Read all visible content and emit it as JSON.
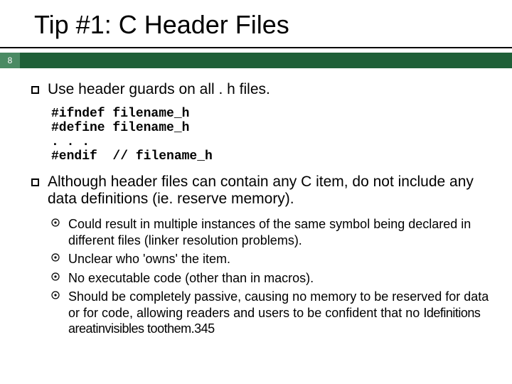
{
  "title": "Tip #1: C Header Files",
  "page_number": "8",
  "bullets": {
    "b1": "Use header guards on all . h files.",
    "code": "#ifndef filename_h\n#define filename_h\n. . .\n#endif  // filename_h",
    "b2": "Although header files can contain any C item, do not include any data definitions (ie. reserve memory).",
    "subs": {
      "s1": "Could result in multiple instances of the same symbol being declared in different files (linker resolution problems).",
      "s2": "Unclear who 'owns' the item.",
      "s3": "No executable code (other than in macros).",
      "s4_prefix": "Should be completely passive, causing no memory to be reserved for data or for code, allowing readers and users to be confident that no ",
      "s4_garble": "Idefinitions areatinvisibles toothem.345"
    }
  }
}
